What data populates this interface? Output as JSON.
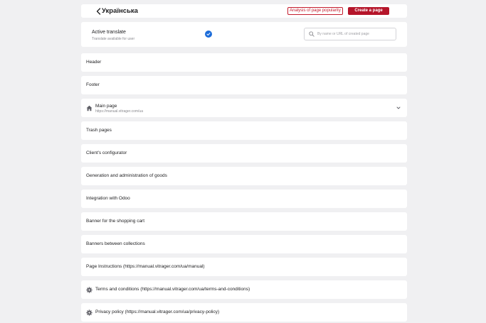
{
  "header": {
    "title": "Українська",
    "analysis_button": "Analysis of page popularity",
    "create_button": "Create a page"
  },
  "settings": {
    "active_label": "Active translate",
    "active_sub": "Translate available for user",
    "active_checked": true,
    "search_placeholder": "By name or URL of created page",
    "search_value": ""
  },
  "pages": [
    {
      "label": "Header",
      "icon": ""
    },
    {
      "label": "Footer",
      "icon": ""
    },
    {
      "label": "Main page",
      "url": "https://manual.vitrager.com/ua",
      "icon": "home-icon",
      "expandable": true
    },
    {
      "label": "Trash pages",
      "icon": ""
    },
    {
      "label": "Client's configurator",
      "icon": ""
    },
    {
      "label": "Generation and administration of goods",
      "icon": ""
    },
    {
      "label": "Integration with Odoo",
      "icon": ""
    },
    {
      "label": "Banner for the shopping cart",
      "icon": ""
    },
    {
      "label": "Banners between collections",
      "icon": ""
    },
    {
      "label": "Page Instructions (https://manual.vitrager.com/ua/manual)",
      "icon": ""
    },
    {
      "label": "Terms and conditions (https://manual.vitrager.com/ua/terms-and-conditions)",
      "icon": "gear-icon"
    },
    {
      "label": "Privacy policy (https://manual.vitrager.com/ua/privacy-policy)",
      "icon": "gear-icon"
    }
  ],
  "colors": {
    "accent": "#b5152a",
    "check": "#1c6cd9",
    "background": "#f0f0f2"
  }
}
